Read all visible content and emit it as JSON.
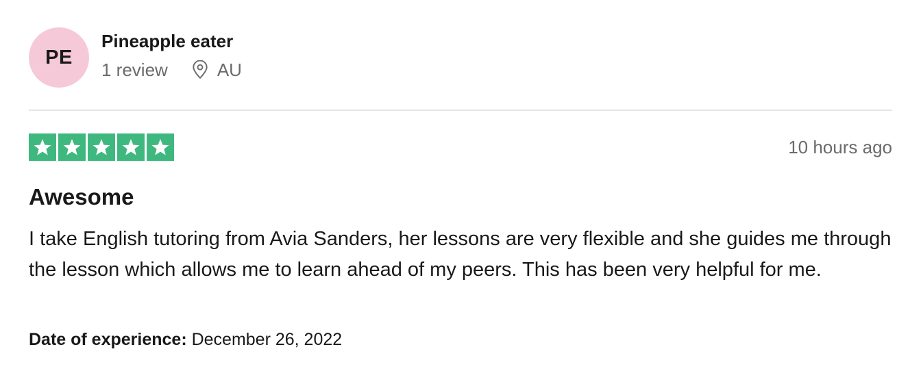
{
  "consumer": {
    "initials": "PE",
    "avatar_color": "#f6c9d8",
    "name": "Pineapple eater",
    "review_count": "1 review",
    "location_icon": "location-pin-icon",
    "country": "AU"
  },
  "review": {
    "rating": 5,
    "max_rating": 5,
    "star_color": "#3fb87f",
    "time_ago": "10 hours ago",
    "title": "Awesome",
    "body": "I take English tutoring from Avia Sanders, her lessons are very flexible and she guides me through the lesson which allows me to learn ahead of my peers. This has been very helpful for me.",
    "date_label": "Date of experience:",
    "date_value": "December 26, 2022"
  }
}
